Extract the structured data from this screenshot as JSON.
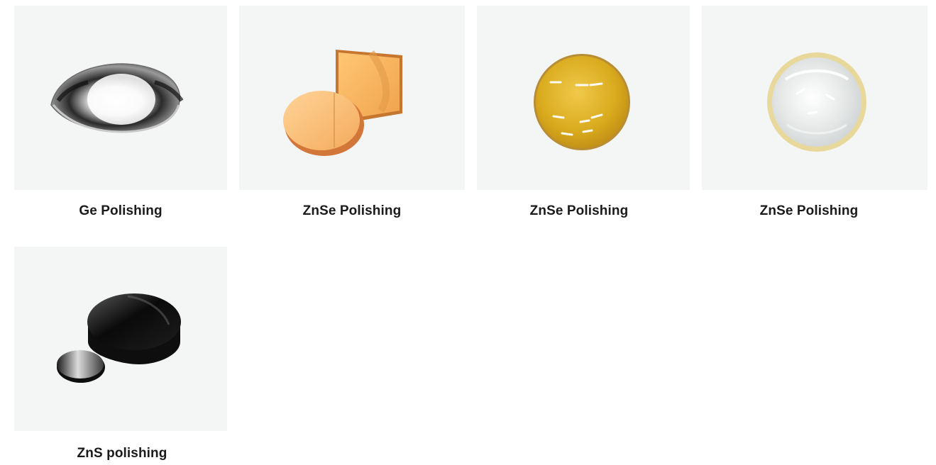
{
  "products": [
    {
      "title": "Ge Polishing",
      "image_icon": "germanium-lens-icon"
    },
    {
      "title": "ZnSe Polishing",
      "image_icon": "znse-window-pair-icon"
    },
    {
      "title": "ZnSe Polishing",
      "image_icon": "znse-round-lens-icon"
    },
    {
      "title": "ZnSe Polishing",
      "image_icon": "znse-clear-lens-icon"
    },
    {
      "title": "ZnS polishing",
      "image_icon": "zns-disc-pair-icon"
    }
  ]
}
